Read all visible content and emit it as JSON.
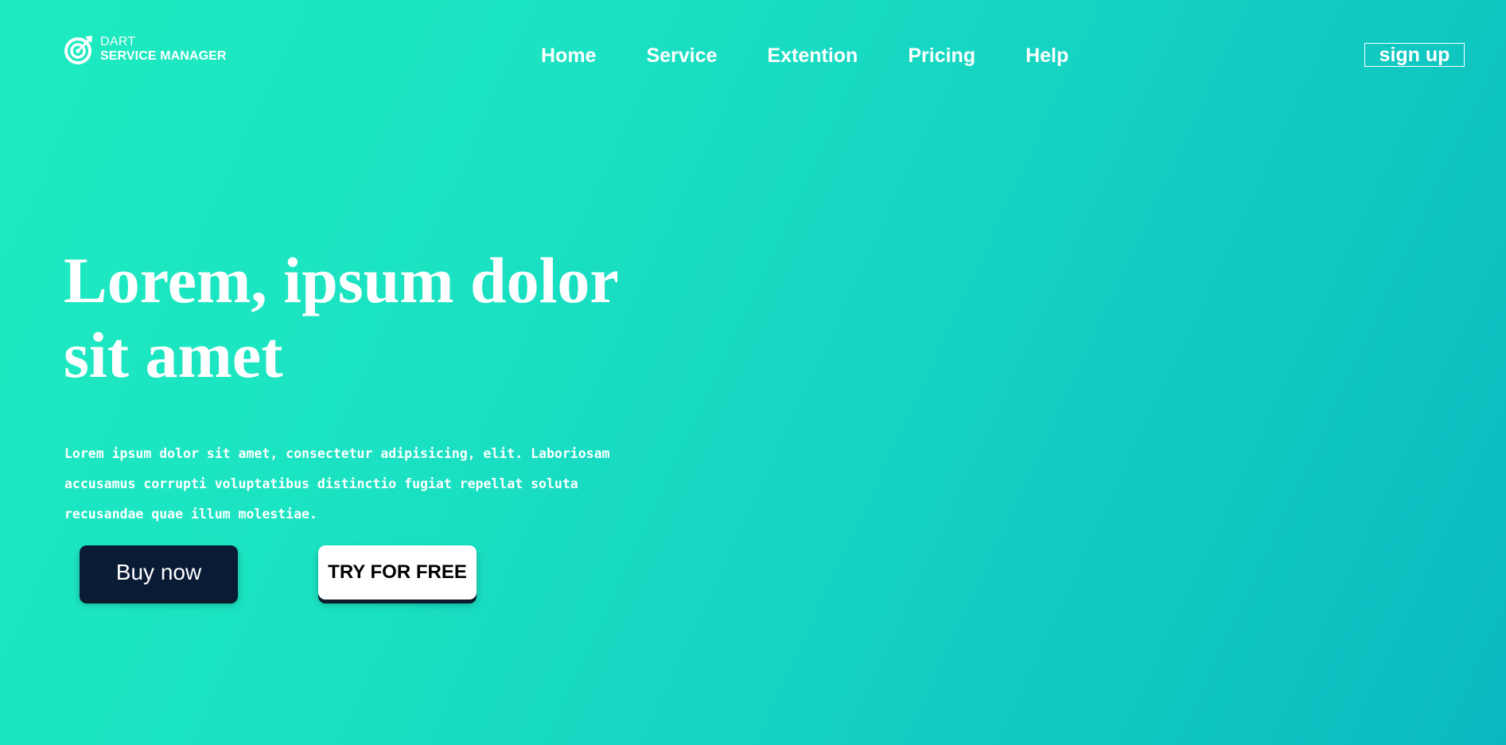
{
  "header": {
    "logo": {
      "line1": "DART",
      "line2": "SERVICE MANAGER",
      "icon": "target-arrow-icon"
    },
    "nav": [
      {
        "label": "Home"
      },
      {
        "label": "Service"
      },
      {
        "label": "Extention"
      },
      {
        "label": "Pricing"
      },
      {
        "label": "Help"
      }
    ],
    "signup_label": "sign up"
  },
  "hero": {
    "title": "Lorem, ipsum dolor sit amet",
    "description": "Lorem ipsum dolor sit amet, consectetur adipisicing, elit. Laboriosam accusamus corrupti voluptatibus distinctio fugiat repellat soluta recusandae quae illum molestiae.",
    "buttons": {
      "primary": "Buy now",
      "secondary": "TRY FOR FREE"
    }
  },
  "colors": {
    "gradient_start": "#1eebc0",
    "gradient_end": "#0ab9c0",
    "buy_button": "#0a1b35",
    "try_button": "#ffffff",
    "text": "#ffffff"
  }
}
